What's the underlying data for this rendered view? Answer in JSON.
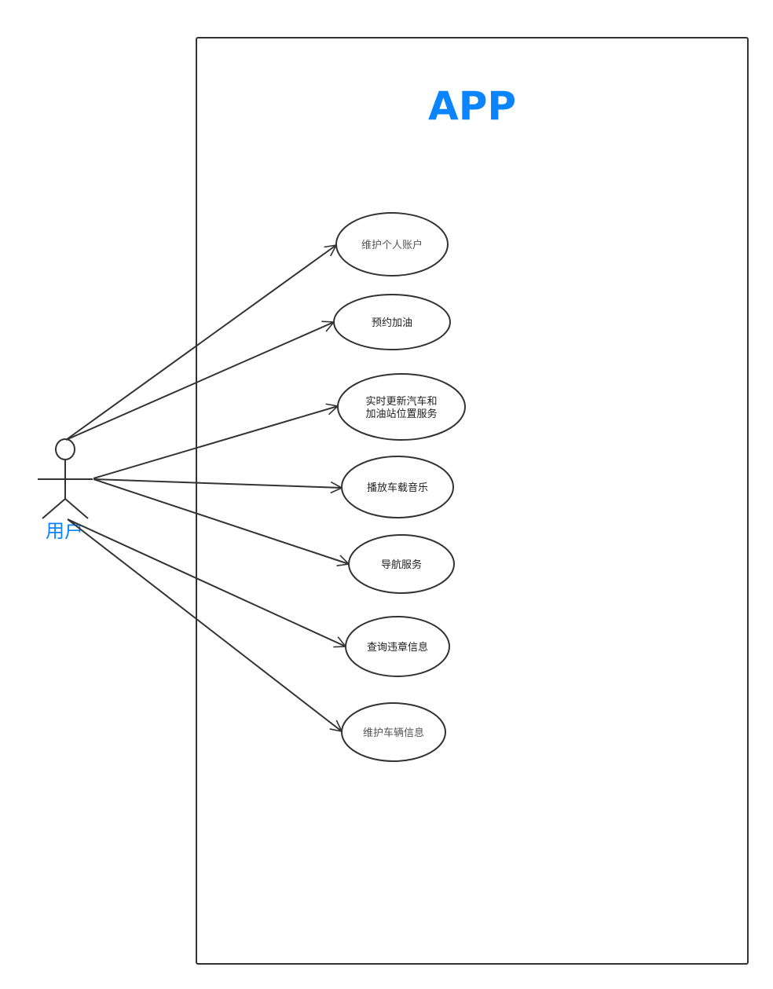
{
  "colors": {
    "stroke": "#333333",
    "accent": "#0a84ff",
    "text": "#222222",
    "text_muted": "#555555"
  },
  "system": {
    "title": "APP"
  },
  "actor": {
    "label": "用户",
    "icon": "stick-figure-icon"
  },
  "use_cases": [
    {
      "id": "maintain-account",
      "lines": [
        "维护个人账户"
      ],
      "muted": true
    },
    {
      "id": "reserve-refuel",
      "lines": [
        "预约加油"
      ],
      "muted": false
    },
    {
      "id": "realtime-location",
      "lines": [
        "实时更新汽车和",
        "加油站位置服务"
      ],
      "muted": false
    },
    {
      "id": "play-music",
      "lines": [
        "播放车载音乐"
      ],
      "muted": false
    },
    {
      "id": "navigation",
      "lines": [
        "导航服务"
      ],
      "muted": false
    },
    {
      "id": "query-violation",
      "lines": [
        "查询违章信息"
      ],
      "muted": false
    },
    {
      "id": "maintain-vehicle",
      "lines": [
        "维护车辆信息"
      ],
      "muted": true
    }
  ]
}
